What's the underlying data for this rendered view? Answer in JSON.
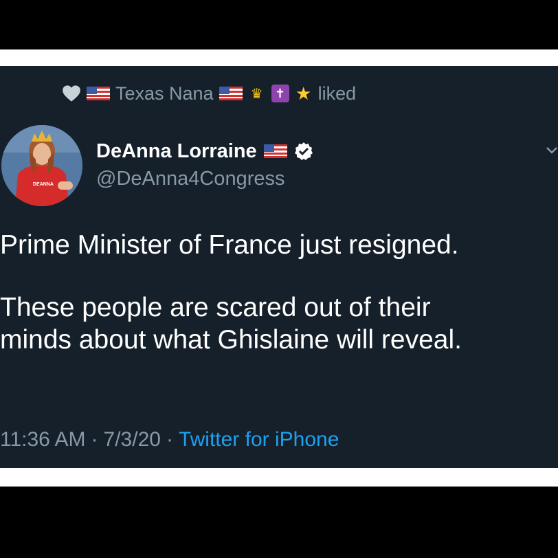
{
  "social_context": {
    "name": "Texas Nana",
    "action": "liked",
    "icons": [
      "heart-icon",
      "us-flag-icon",
      "us-flag-icon",
      "crown-icon",
      "latin-cross-icon",
      "star-icon"
    ],
    "crown_glyph": "♛",
    "cross_glyph": "✝",
    "star_glyph": "★"
  },
  "author": {
    "display_name": "DeAnna Lorraine",
    "handle": "@DeAnna4Congress",
    "avatar_shirt_text": "DEANNA"
  },
  "tweet": {
    "paragraph1": "Prime Minister of France just resigned.",
    "paragraph2_line1": "These people are scared out of their",
    "paragraph2_line2": "minds about what Ghislaine will reveal."
  },
  "meta": {
    "time": "11:36 AM",
    "sep1": "·",
    "date": "7/3/20",
    "sep2": "·",
    "source": "Twitter for iPhone"
  },
  "colors": {
    "background": "#15202b",
    "secondary_text": "#8899a6",
    "link": "#1da1f2",
    "primary_text": "#ffffff"
  }
}
